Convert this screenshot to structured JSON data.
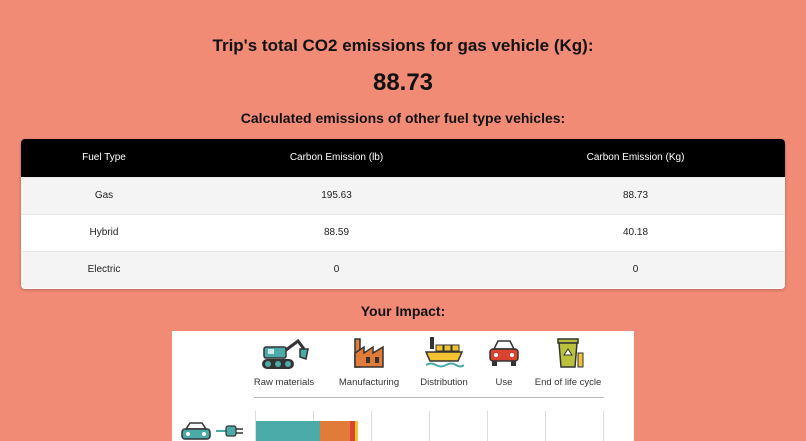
{
  "header": {
    "title": "Trip's total CO2 emissions for gas vehicle (Kg):",
    "total": "88.73",
    "subtitle": "Calculated emissions of other fuel type vehicles:"
  },
  "table": {
    "columns": [
      "Fuel Type",
      "Carbon Emission (lb)",
      "Carbon Emission (Kg)"
    ],
    "rows": [
      [
        "Gas",
        "195.63",
        "88.73"
      ],
      [
        "Hybrid",
        "88.59",
        "40.18"
      ],
      [
        "Electric",
        "0",
        "0"
      ]
    ]
  },
  "impact": {
    "title": "Your Impact:",
    "stages": [
      {
        "label": "Raw materials",
        "icon": "excavator-icon"
      },
      {
        "label": "Manufacturing",
        "icon": "factory-icon"
      },
      {
        "label": "Distribution",
        "icon": "cargo-ship-icon"
      },
      {
        "label": "Use",
        "icon": "car-icon"
      },
      {
        "label": "End of life cycle",
        "icon": "recycle-bin-icon"
      }
    ],
    "row_icons": [
      "car-icon",
      "ev-plug-icon"
    ],
    "colors": {
      "teal": "#4aaba9",
      "orange": "#e07b3a",
      "red": "#d9432f",
      "yellow": "#f2c230"
    }
  }
}
